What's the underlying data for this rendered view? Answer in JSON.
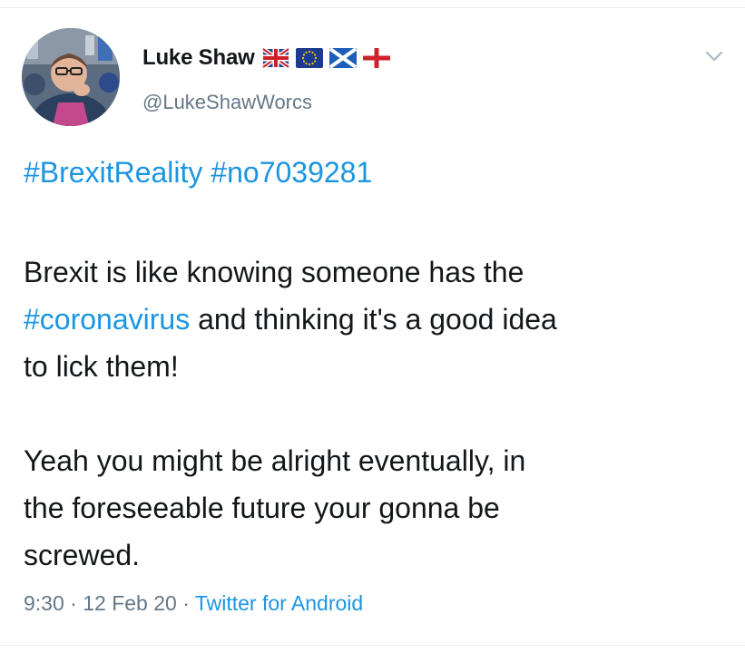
{
  "tweet": {
    "display_name": "Luke Shaw",
    "handle": "@LukeShawWorcs",
    "flags": [
      "uk-flag-icon",
      "eu-flag-icon",
      "scotland-flag-icon",
      "england-flag-icon"
    ],
    "hashtags": [
      "#BrexitReality",
      "#no7039281"
    ],
    "paragraph1": {
      "line1": "Brexit is like knowing someone has the",
      "hashtag": "#coronavirus",
      "line2_rest": " and thinking it's a good idea",
      "line3": "to lick them!"
    },
    "paragraph2": {
      "line1": "Yeah you might be alright eventually, in",
      "line2": "the foreseeable future your gonna be",
      "line3": "screwed."
    },
    "time": "9:30",
    "separator": " · ",
    "date": "12 Feb 20",
    "source": "Twitter for Android"
  },
  "colors": {
    "link": "#1b95e0",
    "secondary_text": "#657786",
    "primary_text": "#14171a"
  }
}
